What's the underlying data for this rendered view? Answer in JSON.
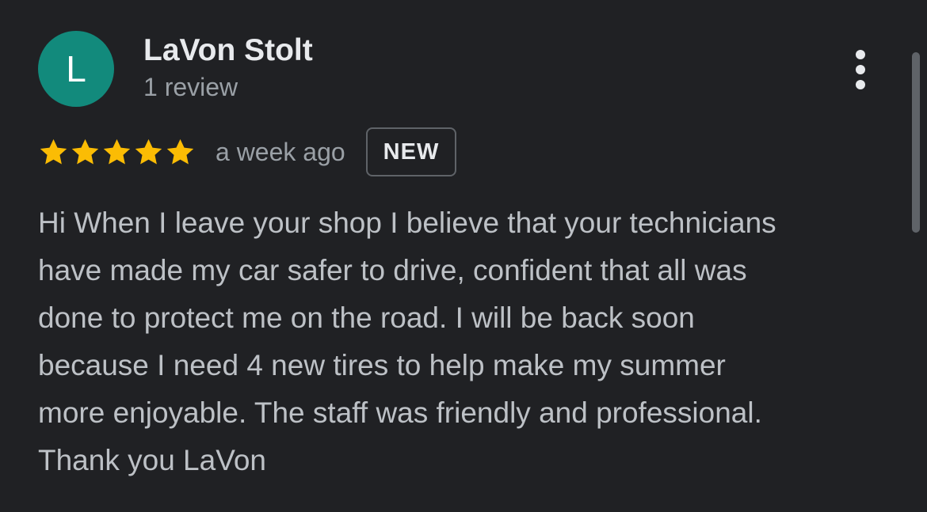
{
  "review": {
    "author": {
      "initial": "L",
      "name": "LaVon Stolt",
      "review_count": "1 review",
      "avatar_color": "#128a7c"
    },
    "rating": 5,
    "rating_max": 5,
    "star_color": "#fbbc04",
    "relative_time": "a week ago",
    "badge": "NEW",
    "text": "Hi When I leave your shop I believe that your technicians\nhave made my car safer to drive, confident that all was\ndone to protect me on the road. I will be back soon\nbecause I need 4 new tires to help make my summer\nmore enjoyable. The staff was friendly and professional.\nThank you LaVon"
  },
  "icons": {
    "menu": "more-vert-icon",
    "star": "star-icon"
  },
  "colors": {
    "background": "#202124",
    "primary_text": "#e8eaed",
    "secondary_text": "#9aa0a6",
    "body_text": "#bdc1c6"
  }
}
